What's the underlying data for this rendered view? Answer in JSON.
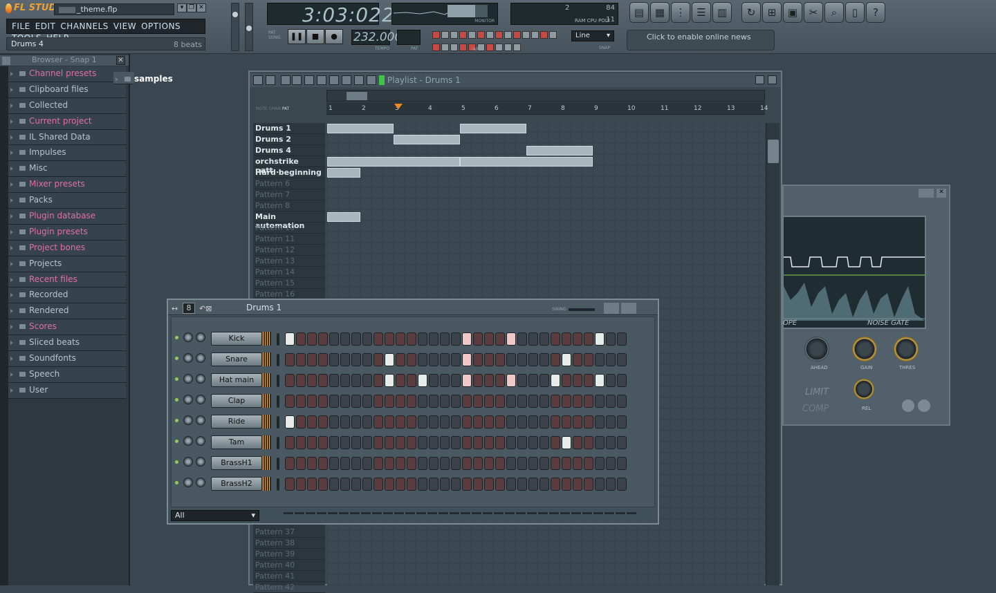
{
  "app": {
    "name": "FL STUDIO",
    "project_file": "_theme.flp",
    "menu": [
      "FILE",
      "EDIT",
      "CHANNELS",
      "VIEW",
      "OPTIONS",
      "TOOLS",
      "HELP"
    ],
    "hint_left": "Drums 4",
    "hint_right": "8 beats",
    "time_display": "3:03:022",
    "tempo": "232.000",
    "tempo_label": "TEMPO",
    "pat_label": "PAT",
    "monitor_label": "MONITOR",
    "cpu_top": "2",
    "cpu_right": "84",
    "cpu_labels": "RAM  CPU  POLY",
    "cpu_poly": "11",
    "mode_pat": "PAT",
    "mode_song": "SONG",
    "snap_select": "Line",
    "snap_label": "SNAP",
    "wait_label": "WAIT",
    "news_text": "Click to enable online news"
  },
  "browser": {
    "title": "Browser - Snap 1",
    "items": [
      {
        "label": "Channel presets",
        "color": "pink"
      },
      {
        "label": "Clipboard files",
        "color": "white"
      },
      {
        "label": "Collected",
        "color": "white"
      },
      {
        "label": "Current project",
        "color": "pink"
      },
      {
        "label": "IL Shared Data",
        "color": "white"
      },
      {
        "label": "Impulses",
        "color": "white"
      },
      {
        "label": "Misc",
        "color": "white"
      },
      {
        "label": "Mixer presets",
        "color": "pink"
      },
      {
        "label": "Packs",
        "color": "white"
      },
      {
        "label": "Plugin database",
        "color": "pink"
      },
      {
        "label": "Plugin presets",
        "color": "pink"
      },
      {
        "label": "Project bones",
        "color": "pink"
      },
      {
        "label": "Projects",
        "color": "white"
      },
      {
        "label": "Recent files",
        "color": "pink"
      },
      {
        "label": "Recorded",
        "color": "white"
      },
      {
        "label": "Rendered",
        "color": "white"
      },
      {
        "label": "samples",
        "color": "selected"
      },
      {
        "label": "Scores",
        "color": "pink"
      },
      {
        "label": "Sliced beats",
        "color": "white"
      },
      {
        "label": "Soundfonts",
        "color": "white"
      },
      {
        "label": "Speech",
        "color": "white"
      },
      {
        "label": "User",
        "color": "white"
      }
    ]
  },
  "playlist": {
    "title": "Playlist - Drums 1",
    "ruler_labels": [
      "NOTE",
      "CHAN",
      "PAT"
    ],
    "ruler": [
      "1",
      "2",
      "3",
      "4",
      "5",
      "6",
      "7",
      "8",
      "9",
      "10",
      "11",
      "12",
      "13",
      "14"
    ],
    "tracks_top": [
      {
        "name": "Drums 1",
        "active": true
      },
      {
        "name": "Drums 2",
        "active": true
      },
      {
        "name": "Drums 4",
        "active": true
      },
      {
        "name": "orchstrike patt...",
        "active": true
      },
      {
        "name": "Hard beginning",
        "active": true
      },
      {
        "name": "Pattern 6",
        "active": false
      },
      {
        "name": "Pattern 7",
        "active": false
      },
      {
        "name": "Pattern 8",
        "active": false
      },
      {
        "name": "Main automation",
        "active": true
      },
      {
        "name": "Pattern 10",
        "active": false
      },
      {
        "name": "Pattern 11",
        "active": false
      },
      {
        "name": "Pattern 12",
        "active": false
      },
      {
        "name": "Pattern 13",
        "active": false
      },
      {
        "name": "Pattern 14",
        "active": false
      },
      {
        "name": "Pattern 15",
        "active": false
      },
      {
        "name": "Pattern 16",
        "active": false
      }
    ],
    "tracks_bottom": [
      "Pattern 37",
      "Pattern 38",
      "Pattern 39",
      "Pattern 40",
      "Pattern 41",
      "Pattern 42"
    ]
  },
  "plugin": {
    "label_envelope": "OPE",
    "label_noise_gate": "NOISE GATE",
    "knobs": [
      "AHEAD",
      "GAIN",
      "THRES",
      "REL"
    ],
    "label_limit": "LIMIT",
    "label_comp": "COMP"
  },
  "rack": {
    "title": "Drums 1",
    "swing_label": "SWING",
    "filter": "All",
    "channels": [
      {
        "name": "Kick",
        "steps": "1000000000000000100010000000100"
      },
      {
        "name": "Snare",
        "steps": "0000000001000000100000000100000"
      },
      {
        "name": "Hat main",
        "steps": "0000000001001000100010001000100"
      },
      {
        "name": "Clap",
        "steps": "0000000000000000000000000000000"
      },
      {
        "name": "Ride",
        "steps": "1000000000000000000000000000000"
      },
      {
        "name": "Tam",
        "steps": "0000000000000000000000000100000"
      },
      {
        "name": "BrassH1",
        "steps": "0000000000000000000000000000000"
      },
      {
        "name": "BrassH2",
        "steps": "0000000000000000000000000000000"
      }
    ]
  }
}
